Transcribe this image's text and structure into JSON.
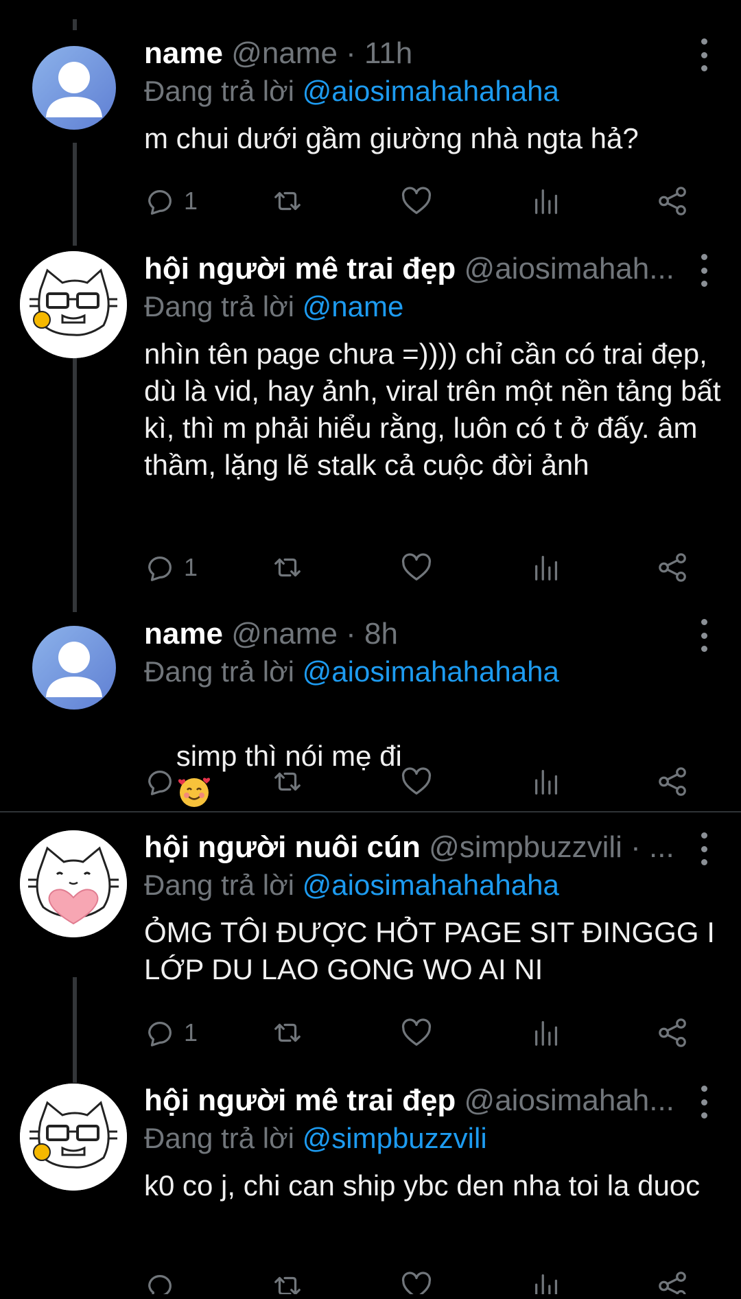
{
  "tweets": [
    {
      "name": "name",
      "handle": "@name",
      "time": "· 11h",
      "replying_label": "Đang trả lời",
      "reply_to": "@aiosimahahahaha",
      "text": "m chui dưới gầm giường nhà ngta hả?",
      "reply_count": "1",
      "avatar": "default-user-avatar"
    },
    {
      "name": "hội người mê trai đẹp",
      "handle": "@aiosimahah...",
      "time": "",
      "replying_label": "Đang trả lời",
      "reply_to": "@name",
      "text": "nhìn tên page chưa =)))) chỉ cần có trai đẹp, dù là vid, hay ảnh, viral trên một nền tảng bất kì, thì m phải hiểu rằng, luôn có t ở đấy. âm thầm, lặng lẽ stalk cả cuộc đời ảnh",
      "reply_count": "1",
      "avatar": "cat-glasses-avatar"
    },
    {
      "name": "name",
      "handle": "@name",
      "time": "· 8h",
      "replying_label": "Đang trả lời",
      "reply_to": "@aiosimahahahaha",
      "text": "simp thì nói mẹ đi",
      "reply_count": "",
      "avatar": "default-user-avatar",
      "emoji": "smiling-face-with-hearts-emoji"
    },
    {
      "name": "hội người nuôi cún",
      "handle": "@simpbuzzvili · ...",
      "time": "",
      "replying_label": "Đang trả lời",
      "reply_to": "@aiosimahahahaha",
      "text": "ỎMG TÔI ĐƯỢC HỎT PAGE SIT ĐINGGG I LỚP DU LAO GONG WO AI NI",
      "reply_count": "1",
      "avatar": "cat-heart-avatar"
    },
    {
      "name": "hội người mê trai đẹp",
      "handle": "@aiosimahah...",
      "time": "",
      "replying_label": "Đang trả lời",
      "reply_to": "@simpbuzzvili",
      "text": "k0 co j, chi can ship ybc den nha toi la duoc",
      "reply_count": "",
      "avatar": "cat-glasses-avatar"
    }
  ],
  "icons": {
    "reply": "reply-icon",
    "retweet": "retweet-icon",
    "like": "like-icon",
    "views": "views-icon",
    "share": "share-icon",
    "more": "more-options-icon"
  },
  "colors": {
    "background": "#000000",
    "text": "#e7e9ea",
    "muted": "#71767b",
    "mention": "#1d9bf0"
  }
}
